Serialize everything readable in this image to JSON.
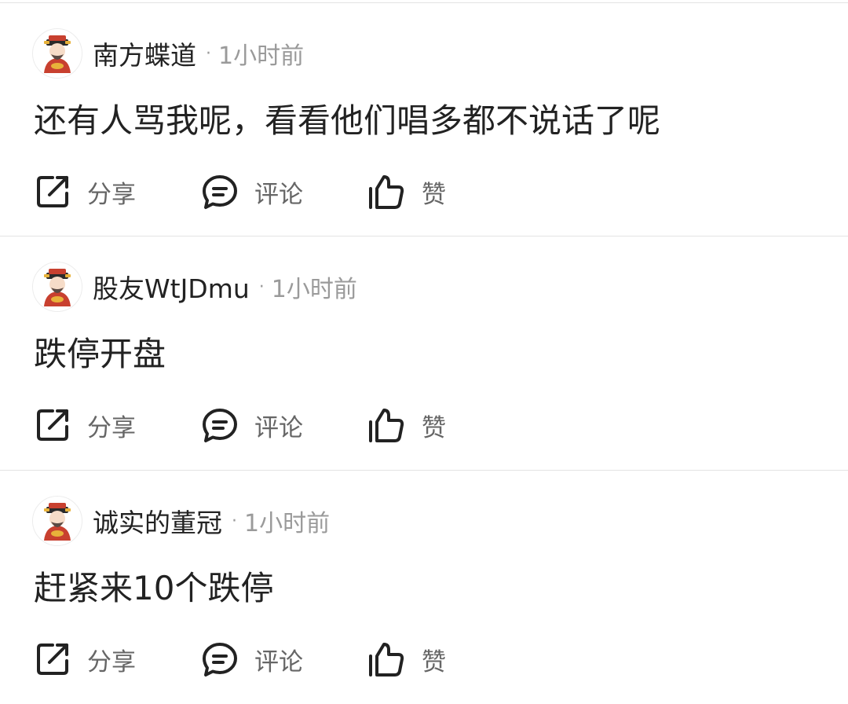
{
  "posts": [
    {
      "username": "南方蝶道",
      "separator": "·",
      "time": "1小时前",
      "content": "还有人骂我呢，看看他们唱多都不说话了呢",
      "avatar_icon": "fortune-god-avatar",
      "actions": {
        "share": "分享",
        "comment": "评论",
        "like": "赞"
      }
    },
    {
      "username": "股友WtJDmu",
      "separator": "·",
      "time": "1小时前",
      "content": "跌停开盘",
      "avatar_icon": "fortune-god-avatar",
      "actions": {
        "share": "分享",
        "comment": "评论",
        "like": "赞"
      }
    },
    {
      "username": "诚实的董冠",
      "separator": "·",
      "time": "1小时前",
      "content": "赶紧来10个跌停",
      "avatar_icon": "fortune-god-avatar",
      "actions": {
        "share": "分享",
        "comment": "评论",
        "like": "赞"
      }
    }
  ],
  "colors": {
    "text": "#222222",
    "meta": "#9a9a9a",
    "action_label": "#666666",
    "icon": "#222222",
    "divider": "#e3e3e3",
    "avatar_robe": "#c8402f",
    "avatar_gold": "#e8b23a"
  }
}
